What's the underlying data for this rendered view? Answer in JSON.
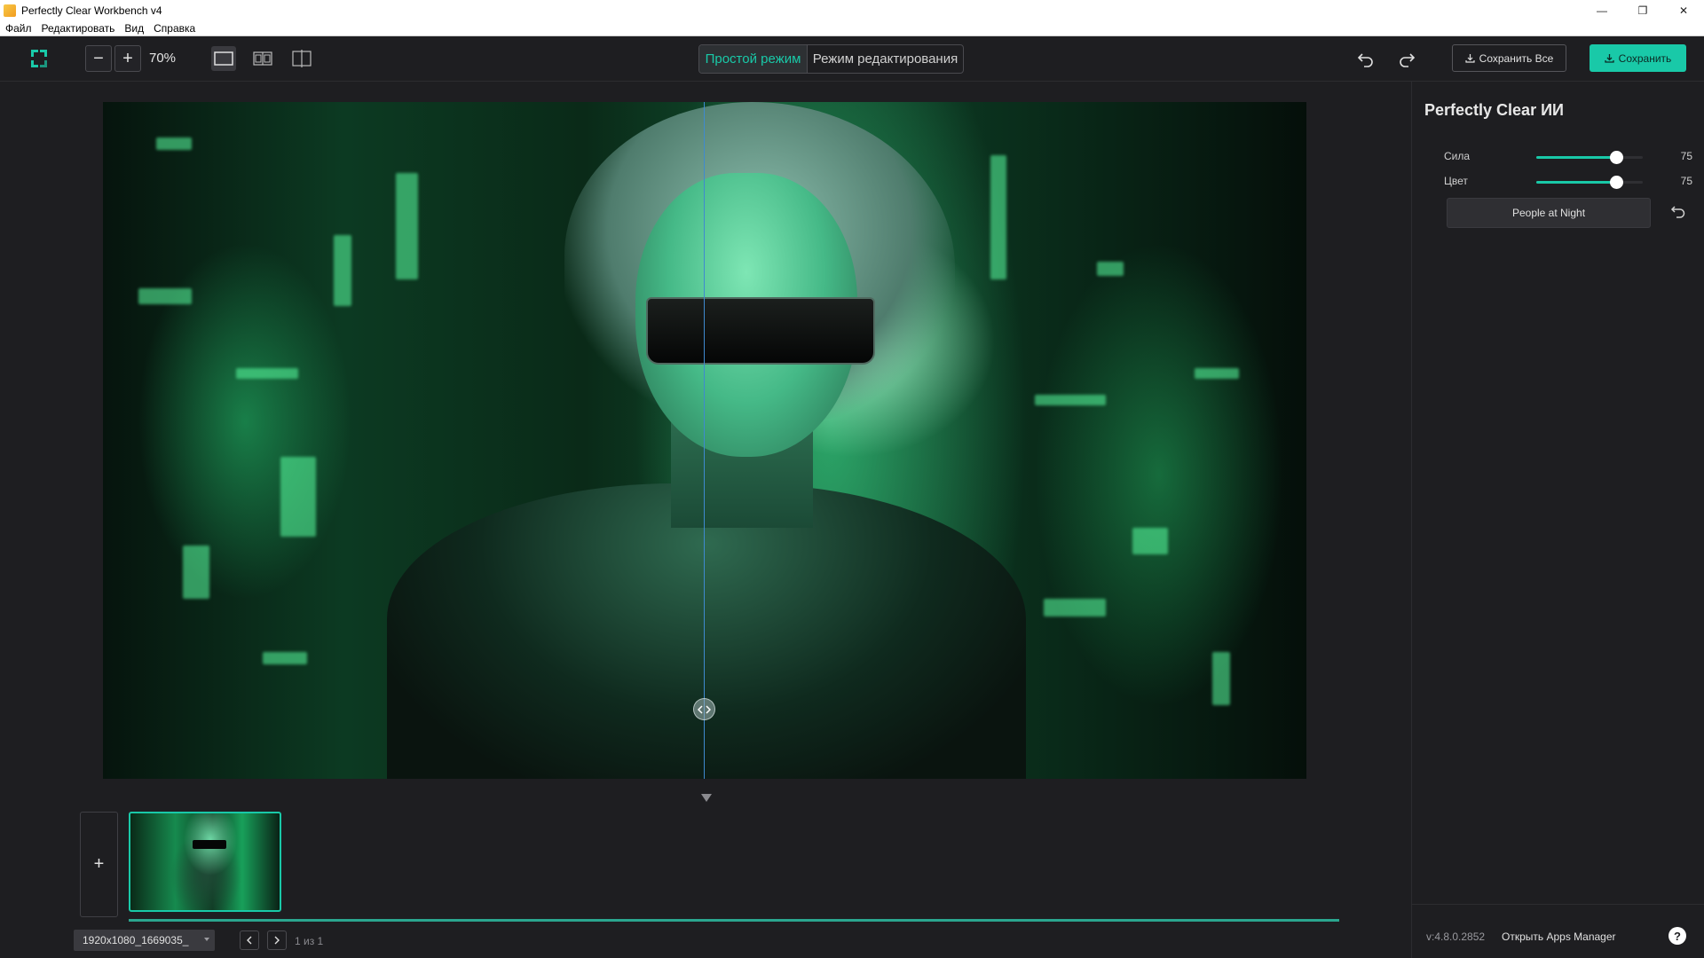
{
  "window": {
    "title": "Perfectly Clear Workbench v4",
    "controls": {
      "minimize": "—",
      "restore": "❐",
      "close": "✕"
    }
  },
  "menu": {
    "items": [
      "Файл",
      "Редактировать",
      "Вид",
      "Справка"
    ]
  },
  "toolbar": {
    "zoom_out": "−",
    "zoom_in": "+",
    "zoom_level": "70%",
    "modes": {
      "simple": "Простой режим",
      "edit": "Режим редактирования"
    },
    "save_all_label": "Сохранить Все",
    "save_label": "Сохранить"
  },
  "filmstrip": {
    "add_label": "+",
    "file_name": "1920x1080_1669035_",
    "page_count": "1 из 1"
  },
  "panel": {
    "title": "Perfectly Clear ИИ",
    "sliders": [
      {
        "label": "Сила",
        "value": "75",
        "fraction": 0.75
      },
      {
        "label": "Цвет",
        "value": "75",
        "fraction": 0.75
      }
    ],
    "preset": "People at Night",
    "version": "v:4.8.0.2852",
    "apps_manager": "Открыть Apps Manager",
    "help": "?"
  },
  "colors": {
    "accent": "#19c9a8",
    "background": "#1e1e21",
    "split_line": "#3f8ad0"
  },
  "icons": {
    "logo": "frame-logo-icon",
    "undo": "undo-icon",
    "redo": "redo-icon",
    "reset": "reset-icon",
    "download": "download-icon"
  }
}
